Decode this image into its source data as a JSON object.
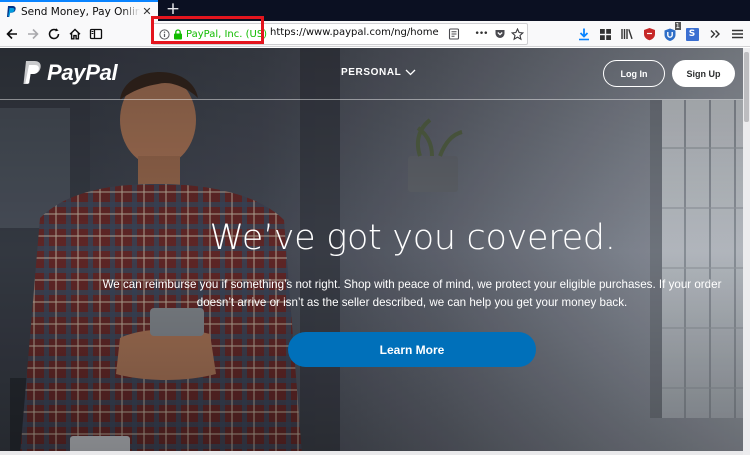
{
  "browser": {
    "tab": {
      "title": "Send Money, Pay Online or Set Up a Merchant Account - PayPal",
      "favicon": "paypal-favicon"
    },
    "new_tab_symbol": "+",
    "tab_close_symbol": "✕",
    "identity_owner": "PayPal, Inc. (US)",
    "url": "https://www.paypal.com/ng/home",
    "more_symbol": "•••",
    "badges": {
      "ublock": "1",
      "stylus": "S"
    },
    "colors": {
      "secure_green": "#12bc00",
      "highlight_red": "#e4151e",
      "download_blue": "#0a84ff"
    }
  },
  "paypal": {
    "logo_text": "PayPal",
    "nav": {
      "personal": "PERSONAL"
    },
    "login_label": "Log In",
    "signup_label": "Sign Up",
    "hero": {
      "title": "We’ve got you covered.",
      "subtitle": "We can reimburse you if something’s not right. Shop with peace of mind, we protect your eligible purchases. If your order doesn’t arrive or isn’t as the seller described, we can help you get your money back.",
      "cta": "Learn More"
    },
    "colors": {
      "cta_blue": "#0070ba"
    }
  }
}
